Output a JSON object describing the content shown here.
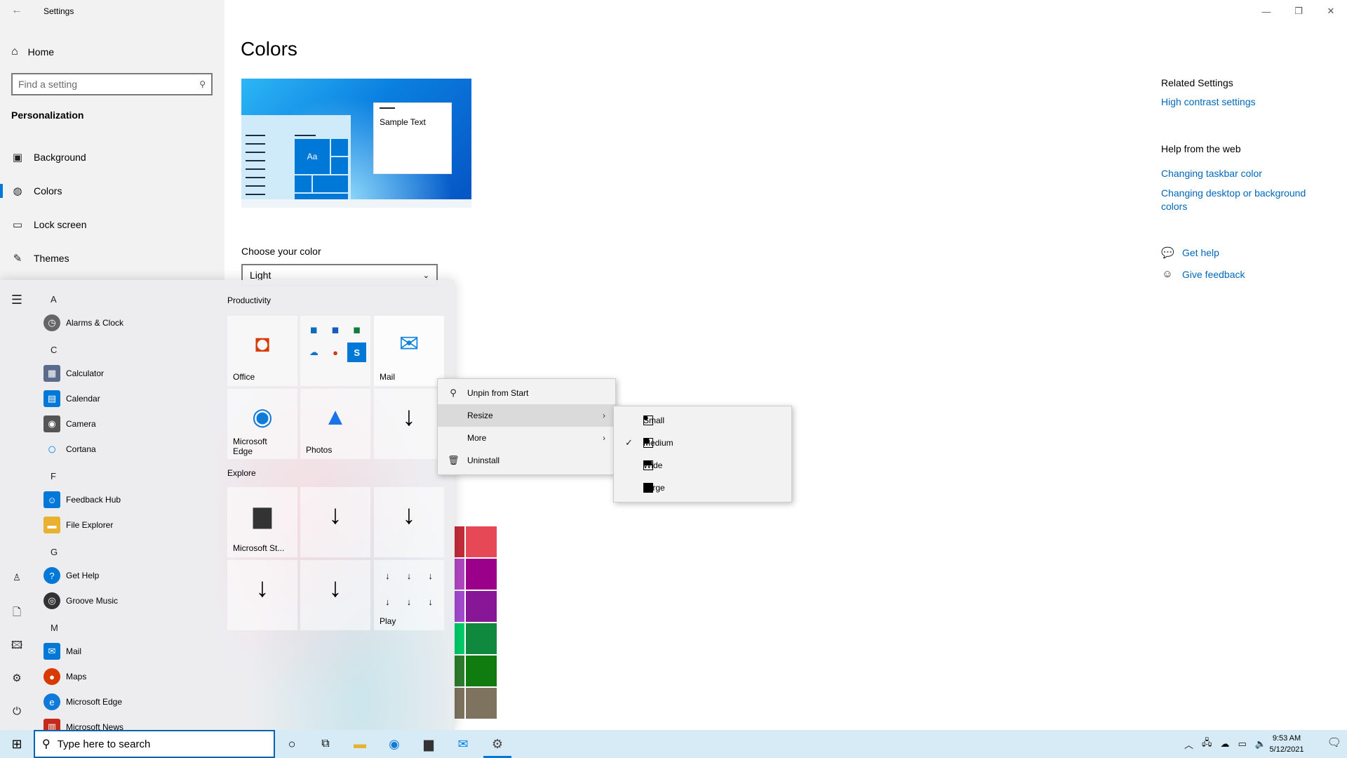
{
  "window": {
    "title": "Settings",
    "back_icon": "arrow-left-icon",
    "controls": [
      "minimize-icon",
      "restore-icon",
      "close-icon"
    ]
  },
  "sidebar": {
    "home_label": "Home",
    "search_placeholder": "Find a setting",
    "section_label": "Personalization",
    "items": [
      {
        "label": "Background",
        "icon": "picture-icon"
      },
      {
        "label": "Colors",
        "icon": "palette-icon",
        "active": true
      },
      {
        "label": "Lock screen",
        "icon": "lock-screen-icon"
      },
      {
        "label": "Themes",
        "icon": "brush-icon"
      }
    ]
  },
  "main": {
    "title": "Colors",
    "preview_sample_text": "Sample Text",
    "preview_tile_text": "Aa",
    "choose_label": "Choose your color",
    "choose_value": "Light",
    "swatches": [
      [
        "#c42b3b",
        "#e74856"
      ],
      [
        "#b146c2",
        "#9a0089"
      ],
      [
        "#a34bd0",
        "#881798"
      ],
      [
        "#00cc6a",
        "#10893e"
      ],
      [
        "#2d7d2d",
        "#107c10"
      ],
      [
        "#7e735f",
        "#7e735f"
      ]
    ]
  },
  "related": {
    "heading": "Related Settings",
    "link": "High contrast settings",
    "web_heading": "Help from the web",
    "web_links": [
      "Changing taskbar color",
      "Changing desktop or background colors"
    ],
    "help_label": "Get help",
    "feedback_label": "Give feedback"
  },
  "start_menu": {
    "rail_icons": [
      "hamburger-icon",
      "user-icon",
      "document-icon",
      "pictures-icon",
      "settings-icon",
      "power-icon"
    ],
    "letters": [
      "A",
      "C",
      "F",
      "G",
      "M"
    ],
    "apps": [
      {
        "label": "Alarms & Clock",
        "color": "#666666"
      },
      {
        "label": "Calculator",
        "color": "#5a6b8c"
      },
      {
        "label": "Calendar",
        "color": "#0078d7"
      },
      {
        "label": "Camera",
        "color": "#555555"
      },
      {
        "label": "Cortana",
        "color": "#1e90ff"
      },
      {
        "label": "Feedback Hub",
        "color": "#0078d7"
      },
      {
        "label": "File Explorer",
        "color": "#e8b130"
      },
      {
        "label": "Get Help",
        "color": "#0078d7"
      },
      {
        "label": "Groove Music",
        "color": "#333333"
      },
      {
        "label": "Mail",
        "color": "#0078d7"
      },
      {
        "label": "Maps",
        "color": "#d83b01"
      },
      {
        "label": "Microsoft Edge",
        "color": "#0f7ad8"
      },
      {
        "label": "Microsoft News",
        "color": "#c42b1c"
      }
    ],
    "groups": [
      "Productivity",
      "Explore"
    ],
    "tiles": {
      "office": "Office",
      "mail": "Mail",
      "edge": "Microsoft Edge",
      "photos": "Photos",
      "store": "Microsoft St...",
      "play": "Play"
    }
  },
  "context_menu": {
    "items": [
      {
        "label": "Unpin from Start",
        "icon": "unpin-icon"
      },
      {
        "label": "Resize",
        "has_submenu": true
      },
      {
        "label": "More",
        "has_submenu": true
      },
      {
        "label": "Uninstall",
        "icon": "trash-icon"
      }
    ],
    "resize_options": [
      {
        "label": "Small",
        "checked": false
      },
      {
        "label": "Medium",
        "checked": true
      },
      {
        "label": "Wide",
        "checked": false
      },
      {
        "label": "Large",
        "checked": false
      }
    ]
  },
  "taskbar": {
    "search_placeholder": "Type here to search",
    "time": "9:53 AM",
    "date": "5/12/2021"
  }
}
